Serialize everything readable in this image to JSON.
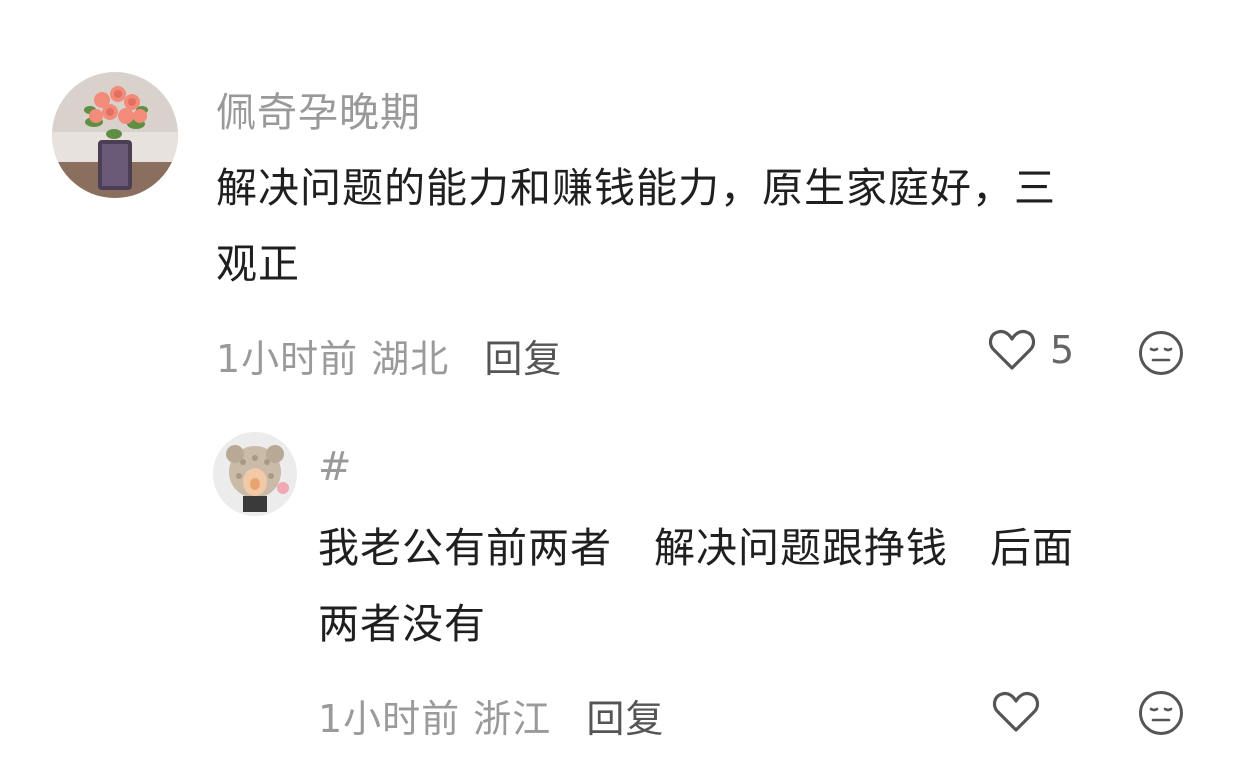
{
  "comments": [
    {
      "username": "佩奇孕晚期",
      "text": "解决问题的能力和赚钱能力，原生家庭好，三\n观正",
      "time": "1小时前",
      "location": "湖北",
      "reply_label": "回复",
      "like_count": "5",
      "avatar_icon": "rose-bouquet-avatar"
    },
    {
      "username": "#",
      "text": "我老公有前两者　解决问题跟挣钱　后面\n两者没有",
      "time": "1小时前",
      "location": "浙江",
      "reply_label": "回复",
      "like_count": "",
      "avatar_icon": "baby-in-knit-hat-avatar"
    }
  ],
  "icons": {
    "like": "heart-outline-icon",
    "dislike": "meh-face-icon"
  },
  "colors": {
    "username": "#999999",
    "meta": "#9a9a9a",
    "reply": "#555555",
    "text": "#1f1f1f"
  }
}
